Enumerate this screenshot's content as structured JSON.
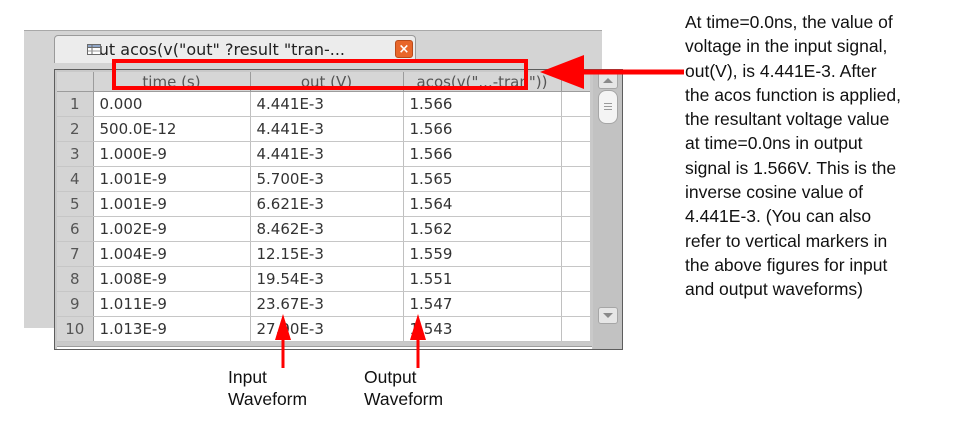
{
  "tab": {
    "title": "out acos(v(\"out\" ?result \"tran-...",
    "close_glyph": "×",
    "icon": "table-icon"
  },
  "table": {
    "columns": [
      "time (s)",
      "out (V)",
      "acos(v(\"...-tran\"))"
    ],
    "rows": [
      {
        "n": "1",
        "time": "0.000",
        "out": "4.441E-3",
        "acos": "1.566"
      },
      {
        "n": "2",
        "time": "500.0E-12",
        "out": "4.441E-3",
        "acos": "1.566"
      },
      {
        "n": "3",
        "time": "1.000E-9",
        "out": "4.441E-3",
        "acos": "1.566"
      },
      {
        "n": "4",
        "time": "1.001E-9",
        "out": "5.700E-3",
        "acos": "1.565"
      },
      {
        "n": "5",
        "time": "1.001E-9",
        "out": "6.621E-3",
        "acos": "1.564"
      },
      {
        "n": "6",
        "time": "1.002E-9",
        "out": "8.462E-3",
        "acos": "1.562"
      },
      {
        "n": "7",
        "time": "1.004E-9",
        "out": "12.15E-3",
        "acos": "1.559"
      },
      {
        "n": "8",
        "time": "1.008E-9",
        "out": "19.54E-3",
        "acos": "1.551"
      },
      {
        "n": "9",
        "time": "1.011E-9",
        "out": "23.67E-3",
        "acos": "1.547"
      },
      {
        "n": "10",
        "time": "1.013E-9",
        "out": "27.90E-3",
        "acos": "1.543"
      }
    ]
  },
  "annotation": {
    "note_lines": [
      "At time=0.0ns, the value of",
      "voltage in the input signal,",
      "out(V), is 4.441E-3. After",
      "the acos function is applied,",
      "the resultant voltage value",
      "at time=0.0ns in output",
      "signal is 1.566V. This is the",
      "inverse cosine value of",
      "4.441E-3. (You can also",
      "refer to vertical markers in",
      "the above figures for input",
      "and output waveforms)"
    ],
    "input_label": [
      "Input",
      "Waveform"
    ],
    "output_label": [
      "Output",
      "Waveform"
    ],
    "accent_color": "#ff0000"
  }
}
